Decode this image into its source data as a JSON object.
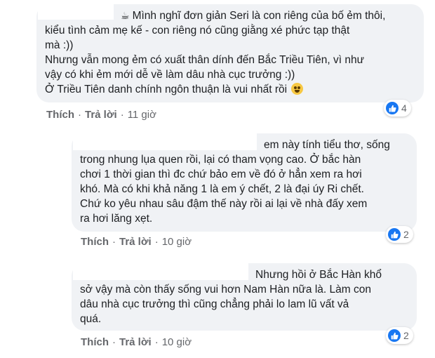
{
  "comments": [
    {
      "lines": [
        "Mình nghĩ đơn giản Seri là con riêng của bố ẻm thôi,",
        "kiểu tình cảm mẹ kế - con riêng nó cũng giằng xé phức tạp thật",
        "mà :))",
        "Nhưng vẫn mong ẻm có xuất thân dính đến Bắc Triều Tiên, vì như",
        "vậy có khi ẻm mới dễ về làm dâu nhà cục trưởng :))",
        "Ở Triều Tiên danh chính ngôn thuận là vui nhất rồi"
      ],
      "like_label": "Thích",
      "reply_label": "Trả lời",
      "time": "11 giờ",
      "reaction_count": "4"
    },
    {
      "lines": [
        "em này tính tiểu thơ, sống",
        "trong nhung lụa quen rồi, lại có tham vọng cao. Ở bắc hàn",
        "chơi 1 thời gian thì đc chứ bảo em về đó ở hẳn xem ra hơi",
        "khó. Mà có khi khả năng 1 là em ý chết, 2 là đại úy Ri chết.",
        "Chứ ko yêu nhau sâu đậm thế này rồi ai lại về nhà đấy xem",
        "ra hơi lăng xẹt."
      ],
      "like_label": "Thích",
      "reply_label": "Trả lời",
      "time": "10 giờ",
      "reaction_count": "2"
    },
    {
      "lines": [
        "Nhưng hồi ở Bắc Hàn khổ",
        "sở vậy mà còn thấy sống vui hơn Nam Hàn nữa là. Làm con",
        "dâu nhà cục trưởng thì cũng chẳng phải lo lam lũ vất vả",
        "quá."
      ],
      "like_label": "Thích",
      "reply_label": "Trả lời",
      "time": "10 giờ",
      "reaction_count": "2"
    }
  ],
  "separator": "·",
  "colors": {
    "bubble": "#f0f2f5",
    "meta": "#65676b",
    "like_blue": "#1877f2"
  },
  "icons": [
    "coffee-icon",
    "crying-face-emoji-icon",
    "like-reaction-icon"
  ]
}
